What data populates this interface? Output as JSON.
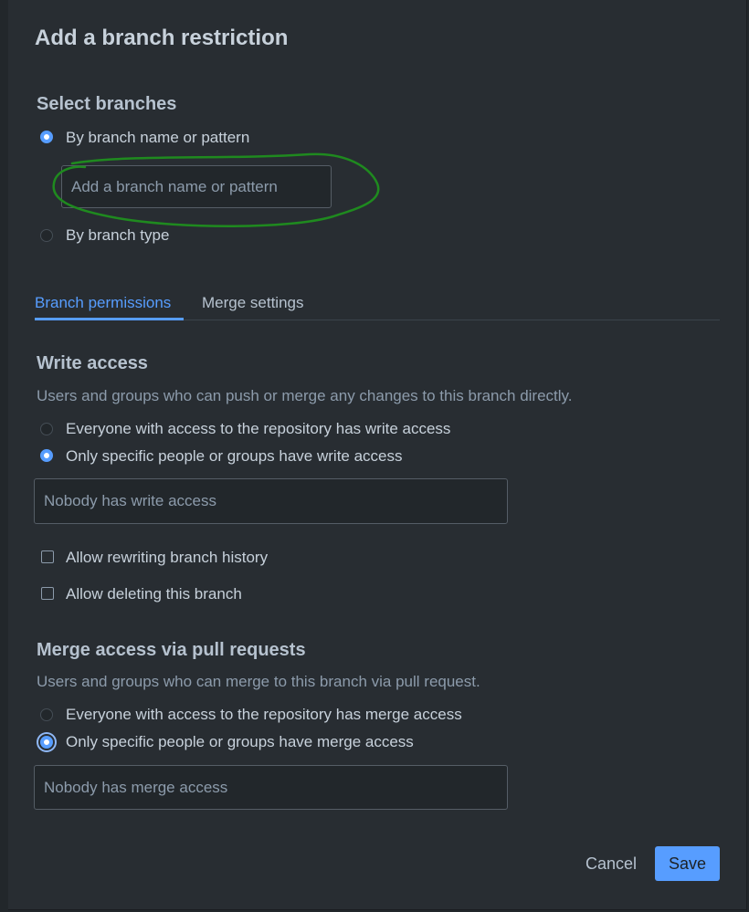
{
  "dialog": {
    "title": "Add a branch restriction"
  },
  "select_branches": {
    "heading": "Select branches",
    "option_name": "By branch name or pattern",
    "option_type": "By branch type",
    "pattern_placeholder": "Add a branch name or pattern",
    "selected": "By branch name or pattern"
  },
  "tabs": [
    {
      "label": "Branch permissions",
      "active": true
    },
    {
      "label": "Merge settings",
      "active": false
    }
  ],
  "write_access": {
    "heading": "Write access",
    "description": "Users and groups who can push or merge any changes to this branch directly.",
    "option_everyone": "Everyone with access to the repository has write access",
    "option_specific": "Only specific people or groups have write access",
    "selected": "Only specific people or groups have write access",
    "input_placeholder": "Nobody has write access"
  },
  "checkboxes": {
    "rewrite": "Allow rewriting branch history",
    "delete": "Allow deleting this branch"
  },
  "merge_access": {
    "heading": "Merge access via pull requests",
    "description": "Users and groups who can merge to this branch via pull request.",
    "option_everyone": "Everyone with access to the repository has merge access",
    "option_specific": "Only specific people or groups have merge access",
    "selected": "Only specific people or groups have merge access",
    "input_placeholder": "Nobody has merge access"
  },
  "footer": {
    "cancel_label": "Cancel",
    "save_label": "Save"
  },
  "colors": {
    "accent": "#579dff",
    "annotation": "#1f8a1f",
    "background": "#282d32"
  }
}
